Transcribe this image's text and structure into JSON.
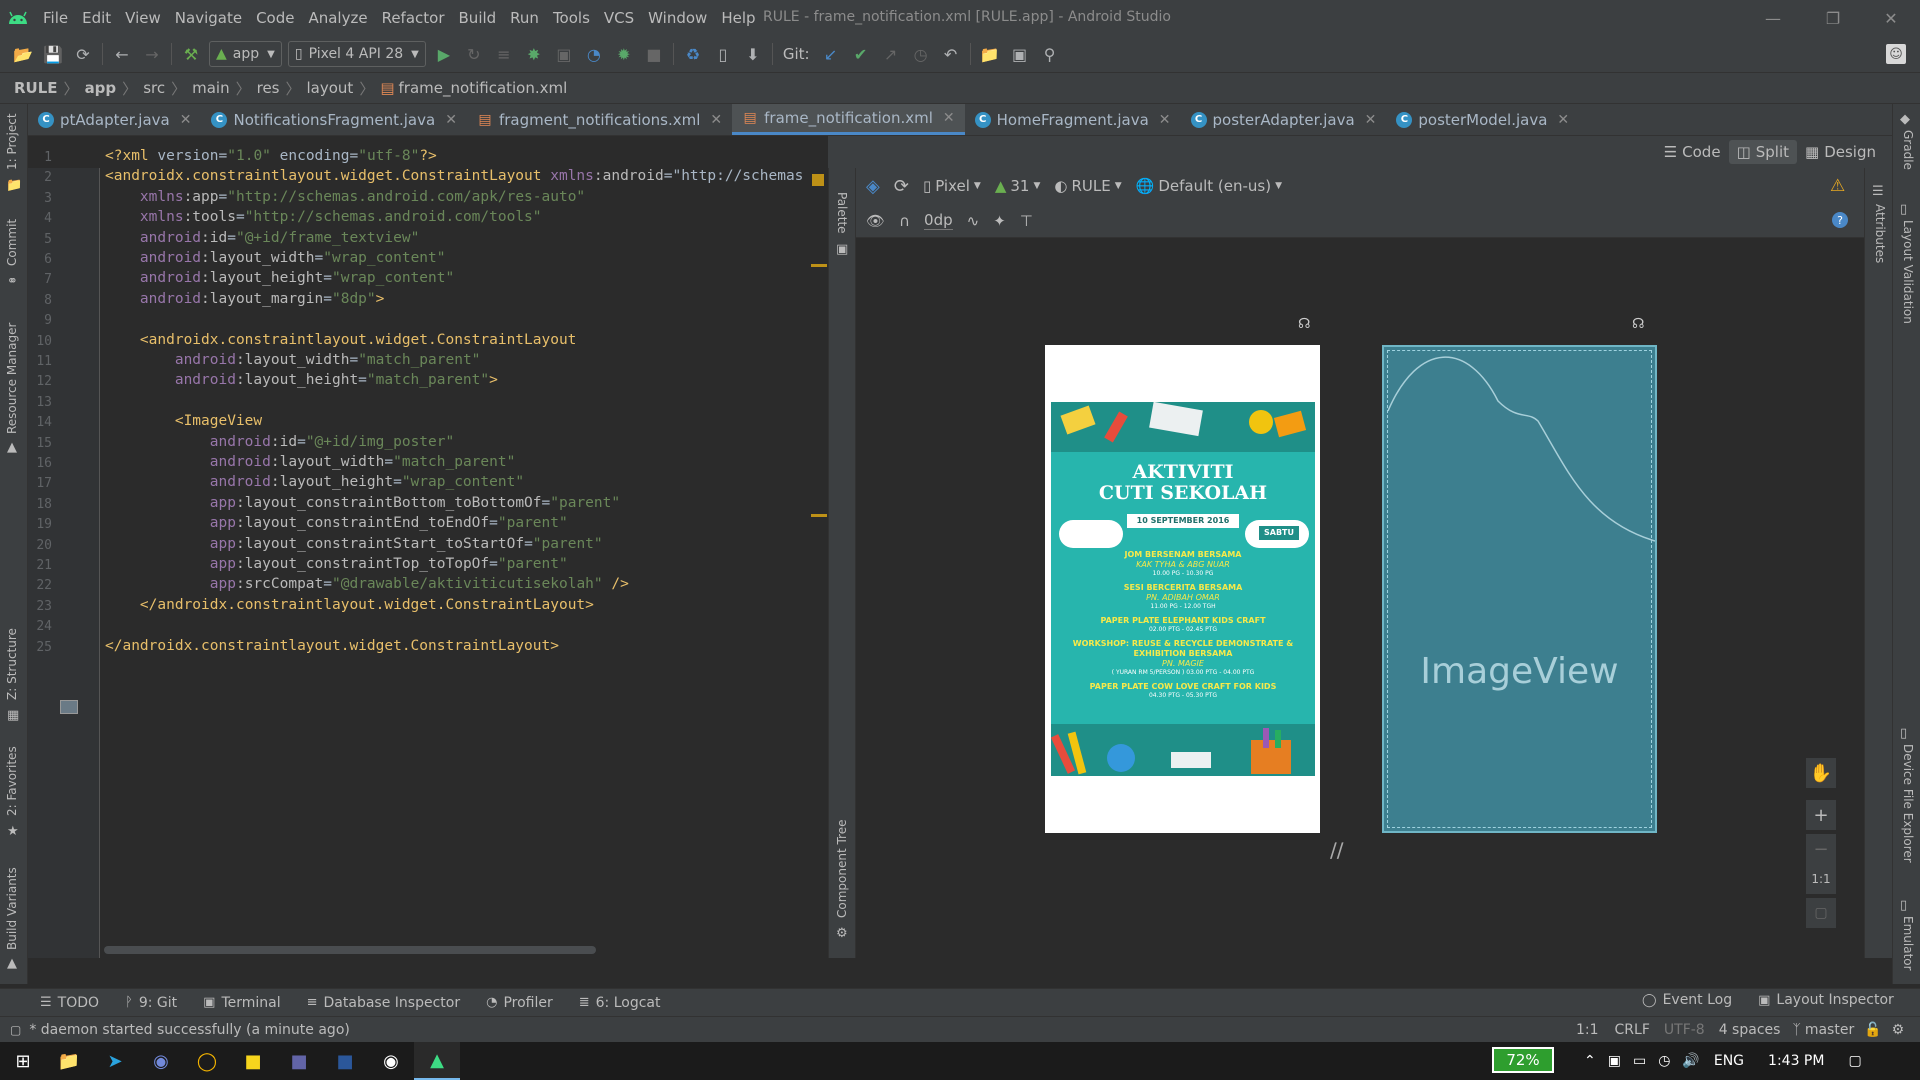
{
  "menu": {
    "items": [
      "File",
      "Edit",
      "View",
      "Navigate",
      "Code",
      "Analyze",
      "Refactor",
      "Build",
      "Run",
      "Tools",
      "VCS",
      "Window",
      "Help"
    ],
    "window_title": "RULE - frame_notification.xml [RULE.app] - Android Studio"
  },
  "toolbar": {
    "run_config": "app",
    "device": "Pixel 4 API 28",
    "git_label": "Git:"
  },
  "breadcrumb": [
    "RULE",
    "app",
    "src",
    "main",
    "res",
    "layout",
    "frame_notification.xml"
  ],
  "tabs": [
    {
      "label": "ptAdapter.java",
      "kind": "java"
    },
    {
      "label": "NotificationsFragment.java",
      "kind": "java"
    },
    {
      "label": "fragment_notifications.xml",
      "kind": "xml"
    },
    {
      "label": "frame_notification.xml",
      "kind": "xml",
      "active": true
    },
    {
      "label": "HomeFragment.java",
      "kind": "java"
    },
    {
      "label": "posterAdapter.java",
      "kind": "java"
    },
    {
      "label": "posterModel.java",
      "kind": "java"
    }
  ],
  "view_modes": {
    "code": "Code",
    "split": "Split",
    "design": "Design"
  },
  "design_toolbar": {
    "device": "Pixel",
    "api": "31",
    "theme": "RULE",
    "locale": "Default (en-us)",
    "margin": "0dp"
  },
  "side_panels": {
    "palette": "Palette",
    "component_tree": "Component Tree",
    "attributes": "Attributes",
    "gradle": "Gradle",
    "layout_validation": "Layout Validation",
    "device_file_explorer": "Device File Explorer",
    "emulator": "Emulator",
    "project": "1: Project",
    "commit": "Commit",
    "resource_manager": "Resource Manager",
    "structure": "Z: Structure",
    "favorites": "2: Favorites",
    "build_variants": "Build Variants"
  },
  "code_lines": [
    "<?xml version=\"1.0\" encoding=\"utf-8\"?>",
    "<androidx.constraintlayout.widget.ConstraintLayout xmlns:android=\"http://schemas",
    "    xmlns:app=\"http://schemas.android.com/apk/res-auto\"",
    "    xmlns:tools=\"http://schemas.android.com/tools\"",
    "    android:id=\"@+id/frame_textview\"",
    "    android:layout_width=\"wrap_content\"",
    "    android:layout_height=\"wrap_content\"",
    "    android:layout_margin=\"8dp\">",
    "",
    "    <androidx.constraintlayout.widget.ConstraintLayout",
    "        android:layout_width=\"match_parent\"",
    "        android:layout_height=\"match_parent\">",
    "",
    "        <ImageView",
    "            android:id=\"@+id/img_poster\"",
    "            android:layout_width=\"match_parent\"",
    "            android:layout_height=\"wrap_content\"",
    "            app:layout_constraintBottom_toBottomOf=\"parent\"",
    "            app:layout_constraintEnd_toEndOf=\"parent\"",
    "            app:layout_constraintStart_toStartOf=\"parent\"",
    "            app:layout_constraintTop_toTopOf=\"parent\"",
    "            app:srcCompat=\"@drawable/aktiviticutisekolah\" />",
    "    </androidx.constraintlayout.widget.ConstraintLayout>",
    "",
    "</androidx.constraintlayout.widget.ConstraintLayout>"
  ],
  "poster": {
    "title_line1": "AKTIVITI",
    "title_line2": "CUTI SEKOLAH",
    "date": "10 SEPTEMBER 2016",
    "day": "SABTU",
    "items": [
      {
        "title": "JOM BERSENAM",
        "sub": "BERSAMA",
        "highlight": "KAK TYHA & ABG NUAR",
        "time": "10.00 PG - 10.30 PG"
      },
      {
        "title": "SESI BERCERITA",
        "sub": "BERSAMA",
        "highlight": "PN. ADIBAH OMAR",
        "time": "11.00 PG - 12.00 TGH"
      },
      {
        "title": "PAPER PLATE ELEPHANT KIDS CRAFT",
        "sub": "",
        "highlight": "",
        "time": "02.00 PTG - 02.45 PTG"
      },
      {
        "title": "WORKSHOP: REUSE & RECYCLE DEMONSTRATE & EXHIBITION",
        "sub": "BERSAMA",
        "highlight": "PN. MAGIE",
        "time": "( YURAN RM 5/PERSON ) 03.00 PTG - 04.00 PTG"
      },
      {
        "title": "PAPER PLATE COW LOVE CRAFT FOR KIDS",
        "sub": "",
        "highlight": "",
        "time": "04.30 PTG - 05.30 PTG"
      }
    ]
  },
  "blueprint_label": "ImageView",
  "zoom": {
    "ratio_label": "1:1"
  },
  "tool_windows": [
    {
      "label": "TODO",
      "icon": "list-icon"
    },
    {
      "label": "9: Git",
      "icon": "git-icon"
    },
    {
      "label": "Terminal",
      "icon": "terminal-icon"
    },
    {
      "label": "Database Inspector",
      "icon": "database-icon"
    },
    {
      "label": "Profiler",
      "icon": "profiler-icon"
    },
    {
      "label": "6: Logcat",
      "icon": "logcat-icon"
    }
  ],
  "tool_windows_right": [
    {
      "label": "Event Log",
      "icon": "event-log-icon"
    },
    {
      "label": "Layout Inspector",
      "icon": "layout-inspector-icon"
    }
  ],
  "status": {
    "message": "* daemon started successfully (a minute ago)",
    "position": "1:1",
    "line_sep": "CRLF",
    "encoding": "UTF-8",
    "indent": "4 spaces",
    "branch": "master"
  },
  "taskbar": {
    "battery": "72%",
    "lang": "ENG",
    "time": "1:43 PM"
  },
  "colors": {
    "accent": "#4a88c7",
    "poster_teal": "#27b5ad",
    "blueprint": "#3d7f8f"
  }
}
